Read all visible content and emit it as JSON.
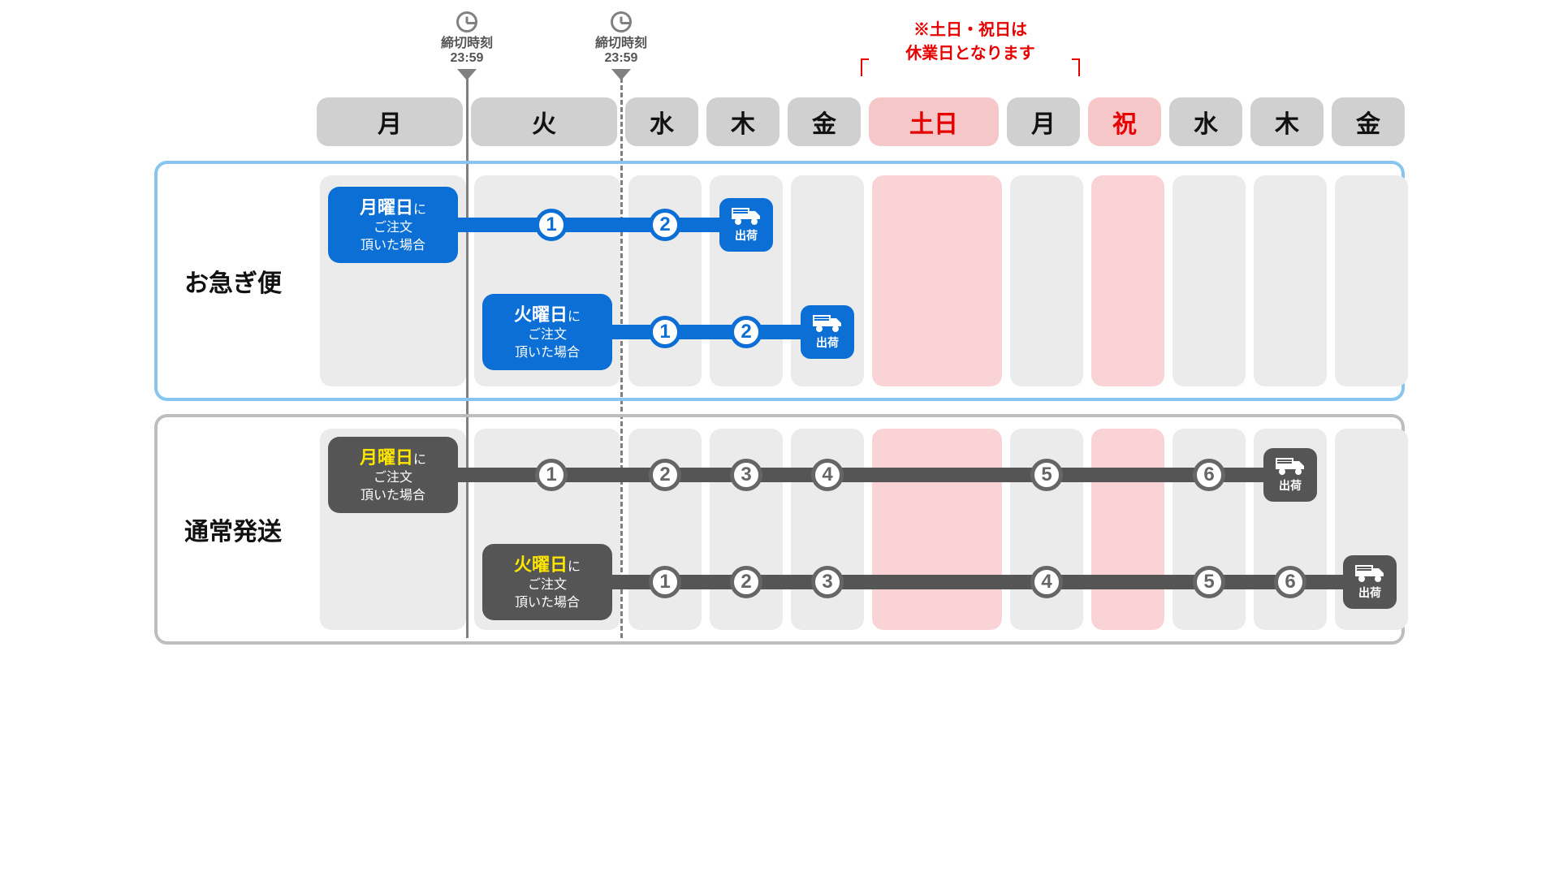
{
  "holiday_note": {
    "line1": "※土日・祝日は",
    "line2": "休業日となります"
  },
  "deadlines": [
    {
      "label": "締切時刻",
      "time": "23:59",
      "style": "solid"
    },
    {
      "label": "締切時刻",
      "time": "23:59",
      "style": "dashed"
    }
  ],
  "days": [
    {
      "label": "月",
      "size": "wide",
      "holiday": false
    },
    {
      "label": "火",
      "size": "wide",
      "holiday": false
    },
    {
      "label": "水",
      "size": "narrow",
      "holiday": false
    },
    {
      "label": "木",
      "size": "narrow",
      "holiday": false
    },
    {
      "label": "金",
      "size": "narrow",
      "holiday": false
    },
    {
      "label": "土日",
      "size": "mid",
      "holiday": true
    },
    {
      "label": "月",
      "size": "narrow",
      "holiday": false
    },
    {
      "label": "祝",
      "size": "narrow",
      "holiday": true
    },
    {
      "label": "水",
      "size": "narrow",
      "holiday": false
    },
    {
      "label": "木",
      "size": "narrow",
      "holiday": false
    },
    {
      "label": "金",
      "size": "narrow",
      "holiday": false
    }
  ],
  "sections": {
    "express": {
      "title": "お急ぎ便"
    },
    "normal": {
      "title": "通常発送"
    }
  },
  "order_card": {
    "mon_day": "月曜日",
    "tue_day": "火曜日",
    "ni": "に",
    "line2": "ご注文",
    "line3": "頂いた場合"
  },
  "ship_label": "出荷",
  "steps": {
    "n1": "1",
    "n2": "2",
    "n3": "3",
    "n4": "4",
    "n5": "5",
    "n6": "6"
  }
}
